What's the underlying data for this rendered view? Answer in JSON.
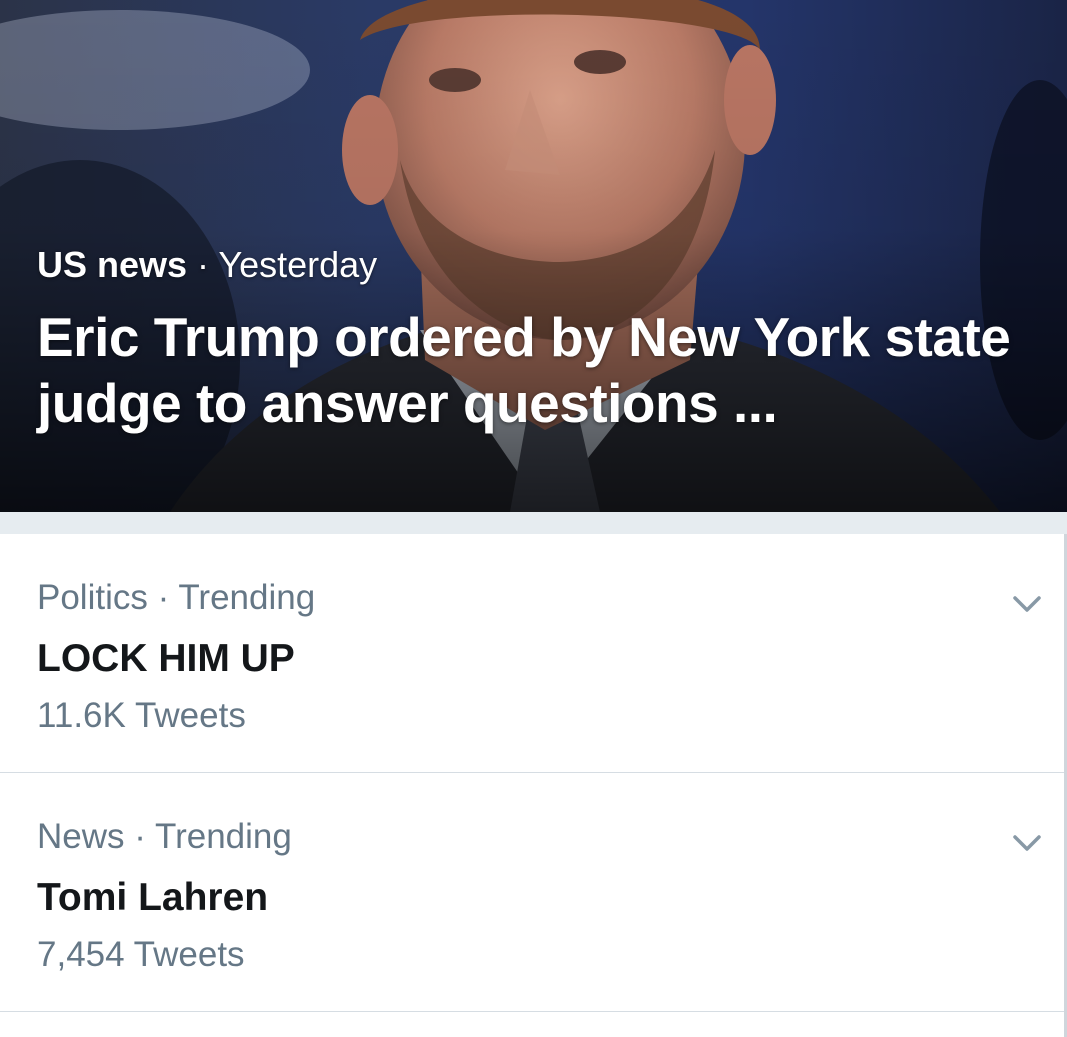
{
  "hero": {
    "category": "US news",
    "separator": " · ",
    "time": "Yesterday",
    "headline": "Eric Trump ordered by New York state judge to answer questions ..."
  },
  "trends": [
    {
      "context": "Politics · Trending",
      "title": "LOCK HIM UP",
      "count": "11.6K Tweets",
      "icon": "chevron-down-icon"
    },
    {
      "context": "News · Trending",
      "title": "Tomi Lahren",
      "count": "7,454 Tweets",
      "icon": "chevron-down-icon"
    }
  ],
  "colors": {
    "secondary_text": "#657786",
    "primary_text": "#14171a",
    "separator": "#e6ecf0",
    "chevron": "#8899a6"
  }
}
